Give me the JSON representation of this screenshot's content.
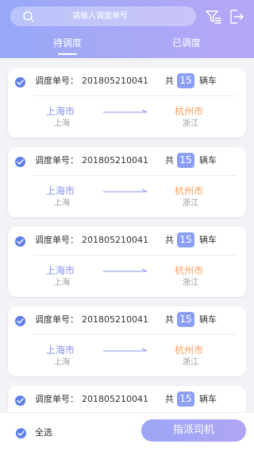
{
  "search": {
    "placeholder": "请输入调度单号"
  },
  "tabs": [
    {
      "label": "待调度",
      "active": true
    },
    {
      "label": "已调度",
      "active": false
    }
  ],
  "cards": [
    {
      "order_label": "调度单号：",
      "order_no": "201805210041",
      "total_prefix": "共",
      "count": "15",
      "total_suffix": "辆车",
      "from_city": "上海市",
      "from_province": "上海",
      "to_city": "杭州市",
      "to_province": "浙江"
    },
    {
      "order_label": "调度单号：",
      "order_no": "201805210041",
      "total_prefix": "共",
      "count": "15",
      "total_suffix": "辆车",
      "from_city": "上海市",
      "from_province": "上海",
      "to_city": "杭州市",
      "to_province": "浙江"
    },
    {
      "order_label": "调度单号：",
      "order_no": "201805210041",
      "total_prefix": "共",
      "count": "15",
      "total_suffix": "辆车",
      "from_city": "上海市",
      "from_province": "上海",
      "to_city": "杭州市",
      "to_province": "浙江"
    },
    {
      "order_label": "调度单号：",
      "order_no": "201805210041",
      "total_prefix": "共",
      "count": "15",
      "total_suffix": "辆车",
      "from_city": "上海市",
      "from_province": "上海",
      "to_city": "杭州市",
      "to_province": "浙江"
    },
    {
      "order_label": "调度单号：",
      "order_no": "201805210041",
      "total_prefix": "共",
      "count": "15",
      "total_suffix": "辆车"
    }
  ],
  "bottom": {
    "select_all_label": "全选",
    "dispatch_label": "指派司机"
  },
  "icons": {
    "search": "search-icon",
    "filter": "filter-icon",
    "logout": "logout-icon",
    "check": "check-circle-icon",
    "arrow": "route-arrow-icon"
  },
  "colors": {
    "accent": "#8c9ff2",
    "check": "#5f7fe8",
    "from_city": "#8593ef",
    "to_city": "#f5a061"
  }
}
